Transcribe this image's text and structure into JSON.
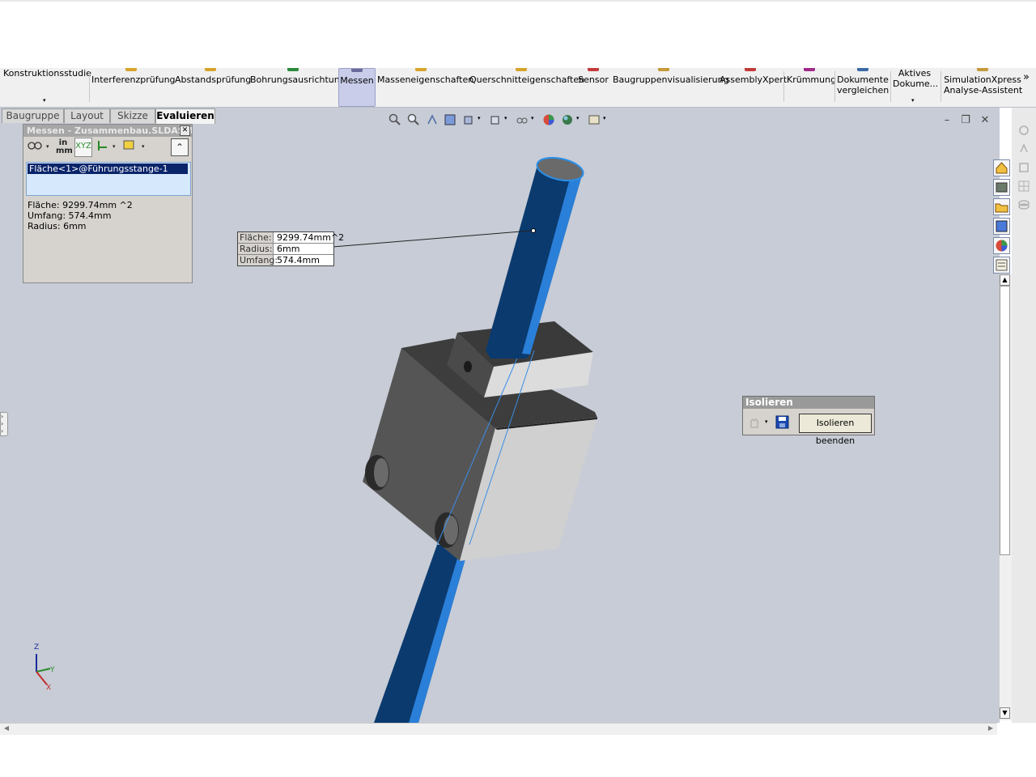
{
  "ribbon": {
    "items": [
      {
        "label": "Konstruktionsstudie",
        "icon": "study-icon"
      },
      {
        "label": "Interferenzprüfung",
        "icon": "interference-icon"
      },
      {
        "label": "Abstandsprüfung",
        "icon": "clearance-icon"
      },
      {
        "label": "Bohrungsausrichtung",
        "icon": "hole-alignment-icon"
      },
      {
        "label": "Messen",
        "icon": "measure-icon",
        "active": true
      },
      {
        "label": "Masseneigenschaften",
        "icon": "mass-properties-icon"
      },
      {
        "label": "Querschnitteigenschaften",
        "icon": "section-properties-icon"
      },
      {
        "label": "Sensor",
        "icon": "sensor-icon"
      },
      {
        "label": "Baugruppenvisualisierung",
        "icon": "assembly-visualization-icon"
      },
      {
        "label": "AssemblyXpert",
        "icon": "assemblyxpert-icon"
      },
      {
        "label": "Krümmung",
        "icon": "curvature-icon"
      },
      {
        "label": "Dokumente\nvergleichen",
        "icon": "compare-documents-icon"
      },
      {
        "label": "Aktives\nDokume...",
        "icon": "active-document-icon"
      },
      {
        "label": "SimulationXpress\nAnalyse-Assistent",
        "icon": "simulationxpress-icon"
      }
    ],
    "more": "»"
  },
  "tabs": [
    "Baugruppe",
    "Layout",
    "Skizze",
    "Evaluieren"
  ],
  "measure": {
    "title": "Messen - Zusammenbau.SLDASM",
    "unit_in": "in",
    "unit_mm": "mm",
    "xyz": "XYZ",
    "selection": "Fläche<1>@Führungsstange-1",
    "results": [
      "Fläche:  9299.74mm ^2",
      "Umfang: 574.4mm",
      "Radius: 6mm"
    ],
    "close": "✕",
    "collapse": "⌃"
  },
  "callout": {
    "rows": [
      {
        "key": "Fläche:",
        "value": "9299.74mm^2"
      },
      {
        "key": "Radius:",
        "value": "6mm"
      },
      {
        "key": "Umfang:",
        "value": "574.4mm"
      }
    ]
  },
  "isolate": {
    "title": "Isolieren",
    "end_button": "Isolieren beenden"
  },
  "triad": {
    "x": "X",
    "y": "Y",
    "z": "Z"
  },
  "window_controls": {
    "minimize": "–",
    "restore": "❐",
    "close": "✕"
  },
  "colors": {
    "viewport_bg": "#c7ccd6",
    "rod_blue": "#0b3a6e",
    "rod_highlight": "#2a8fe8",
    "block_dark": "#4a4a4a",
    "block_light": "#d8d8d8",
    "active_tab": "#c9cde9"
  }
}
